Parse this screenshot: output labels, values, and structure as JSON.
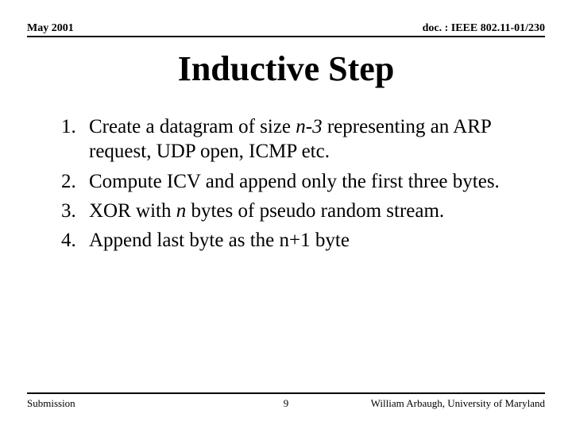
{
  "header": {
    "date": "May 2001",
    "docref": "doc. : IEEE 802.11-01/230"
  },
  "title": "Inductive Step",
  "items": {
    "i1a": "Create a datagram of size ",
    "i1_em": "n-3",
    "i1b": " representing an ARP request, UDP open, ICMP etc.",
    "i2": "Compute ICV and append only the first three bytes.",
    "i3a": "XOR with ",
    "i3_em": "n",
    "i3b": " bytes of pseudo random stream.",
    "i4": "Append last byte as the n+1 byte"
  },
  "footer": {
    "left": "Submission",
    "page": "9",
    "right": "William Arbaugh, University of Maryland"
  }
}
